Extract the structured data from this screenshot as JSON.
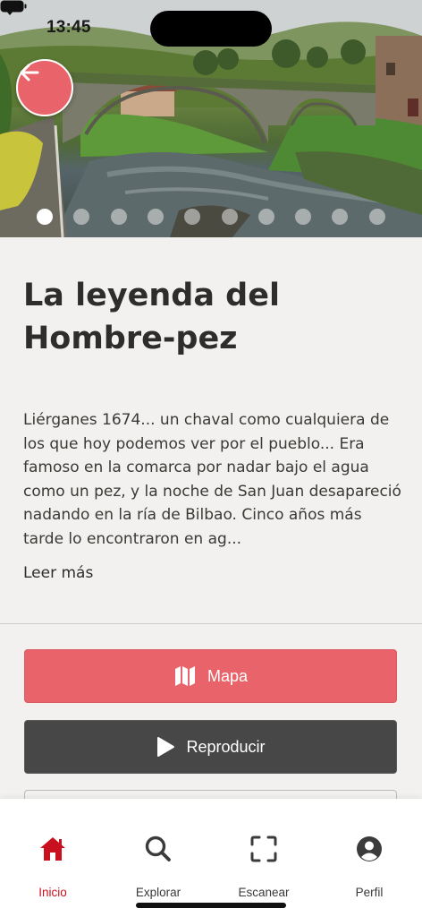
{
  "status": {
    "time": "13:45"
  },
  "hero": {
    "image_alt": "Stone arch bridge over river",
    "dots_total": 10,
    "dots_active": 0
  },
  "story": {
    "title": "La leyenda del Hombre-pez",
    "body": "Liérganes 1674... un chaval como cualquiera de los que hoy podemos ver por el pueblo... Era famoso en la comarca por nadar bajo el agua como un pez, y la noche de San Juan desapareció nadando en la ría de Bilbao. Cinco años más tarde lo encontraron en ag...",
    "read_more": "Leer más"
  },
  "actions": {
    "map_label": "Mapa",
    "play_label": "Reproducir"
  },
  "tabbar": {
    "items": [
      {
        "label": "Inicio",
        "icon": "home-icon",
        "active": true
      },
      {
        "label": "Explorar",
        "icon": "search-icon",
        "active": false
      },
      {
        "label": "Escanear",
        "icon": "scan-icon",
        "active": false
      },
      {
        "label": "Perfil",
        "icon": "profile-icon",
        "active": false
      }
    ]
  },
  "colors": {
    "accent": "#e8636a",
    "active_tab": "#c8101e",
    "dark_button": "#474747",
    "background": "#f2f1ef"
  }
}
